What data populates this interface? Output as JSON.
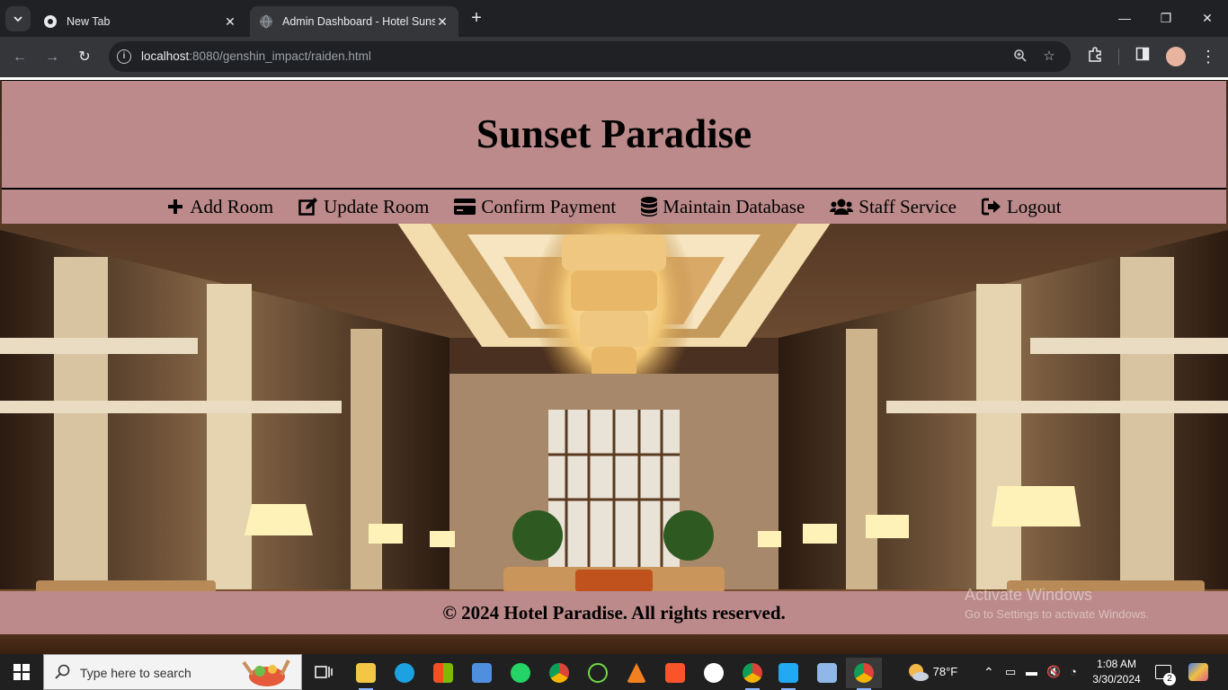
{
  "browser": {
    "tabs": [
      {
        "title": "New Tab",
        "active": false
      },
      {
        "title": "Admin Dashboard - Hotel Sunset Paradise",
        "active": true
      }
    ],
    "url_host": "localhost",
    "url_rest": ":8080/genshin_impact/raiden.html"
  },
  "page": {
    "title": "Sunset Paradise",
    "nav": [
      {
        "label": "Add Room",
        "icon": "plus-icon"
      },
      {
        "label": "Update Room",
        "icon": "edit-icon"
      },
      {
        "label": "Confirm Payment",
        "icon": "credit-card-icon"
      },
      {
        "label": "Maintain Database",
        "icon": "database-icon"
      },
      {
        "label": "Staff Service",
        "icon": "users-icon"
      },
      {
        "label": "Logout",
        "icon": "sign-out-icon"
      }
    ],
    "footer": "© 2024 Hotel Paradise. All rights reserved.",
    "header_color": "#bc8a8a"
  },
  "os": {
    "activate_title": "Activate Windows",
    "activate_sub": "Go to Settings to activate Windows.",
    "search_placeholder": "Type here to search",
    "weather": "78°F",
    "time": "1:08 AM",
    "date": "3/30/2024",
    "notifications": "2"
  }
}
